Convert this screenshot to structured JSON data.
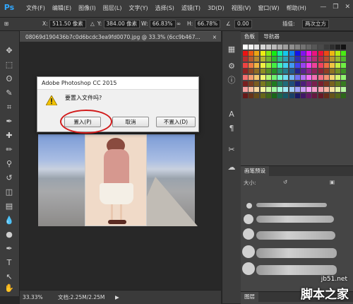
{
  "app": {
    "logo": "Ps"
  },
  "menubar": {
    "items": [
      "文件(F)",
      "编辑(E)",
      "图像(I)",
      "图层(L)",
      "文字(Y)",
      "选择(S)",
      "滤镜(T)",
      "3D(D)",
      "视图(V)",
      "窗口(W)",
      "帮助(H)"
    ],
    "minimize": "—",
    "restore": "❐",
    "close": "✕"
  },
  "options": {
    "x_label": "X:",
    "x_value": "511.50 像素",
    "y_label": "Y:",
    "y_value": "384.00 像素",
    "w_label": "W:",
    "w_value": "66.83%",
    "h_label": "H:",
    "h_value": "66.78%",
    "angle_value": "0.00",
    "interp_label": "插值:",
    "interp_value": "两次立方"
  },
  "document": {
    "tab_title": "08069d190436b7c0d6bcdc3ea9fd0070.jpg @ 33.3% (6cc9b467...",
    "tab_close": "×"
  },
  "dialog": {
    "title": "Adobe Photoshop CC 2015",
    "message": "要置入文件吗?",
    "buttons": {
      "place": "置入(P)",
      "cancel": "取消",
      "dont_place": "不置入(D)"
    }
  },
  "status": {
    "zoom": "33.33%",
    "doc_info": "文档:2.25M/2.25M",
    "arrow": "▶"
  },
  "panels": {
    "swatches_tabs": [
      "色板",
      "导航器"
    ],
    "brushes_tab": "画笔预设",
    "brush_size_label": "大小:",
    "layers_tab": "图层"
  },
  "colors": {
    "accent": "#31a8ff",
    "highlight": "#d11a1a"
  },
  "watermark": {
    "site": "jb51.net",
    "text": "脚本之家"
  }
}
